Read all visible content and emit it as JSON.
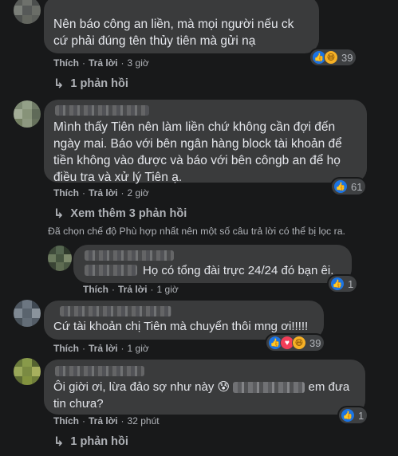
{
  "action_labels": {
    "like": "Thích",
    "reply": "Trả lời"
  },
  "comments": [
    {
      "text": "Nên báo công an liền, mà mọi người nếu ck cứ phải đúng tên thủy tiên mà gửi nạ",
      "time": "3 giờ",
      "reaction_count": "39",
      "reactions": [
        "like-icon",
        "haha-icon"
      ],
      "replies_label": "1 phản hồi"
    },
    {
      "text": "Mình thấy Tiên nên làm liền chứ không cần đợi đến ngày mai. Báo với bên ngân hàng block tài khoản để tiền không vào được và báo với bên côngb an để họ điều tra và xử lý Tiên ạ.",
      "time": "2 giờ",
      "reaction_count": "61",
      "reactions": [
        "like-icon"
      ],
      "replies_label": "Xem thêm 3 phản hồi"
    }
  ],
  "filter_notice": "Đã chọn chế độ Phù hợp nhất nên một số câu trả lời có thể bị lọc ra.",
  "reply": {
    "text": "Họ có tổng đài trực 24/24 đó bạn êi.",
    "time": "1 giờ",
    "reaction_count": "1",
    "reactions": [
      "like-icon"
    ]
  },
  "comment3": {
    "text": "Cứ tài khoản chị Tiên mà chuyển thôi mng ơi!!!!!",
    "time": "1 giờ",
    "reaction_count": "39",
    "reactions": [
      "like-icon",
      "love-icon",
      "haha-icon"
    ]
  },
  "comment4": {
    "text_start": "Ôi giời ơi, lừa đảo sợ như này ",
    "emoji": "😰",
    "text_end": " em đưa",
    "text_line2": "tin chưa?",
    "time": "32 phút",
    "reaction_count": "1",
    "reactions": [
      "like-icon"
    ],
    "replies_label": "1 phản hồi"
  }
}
